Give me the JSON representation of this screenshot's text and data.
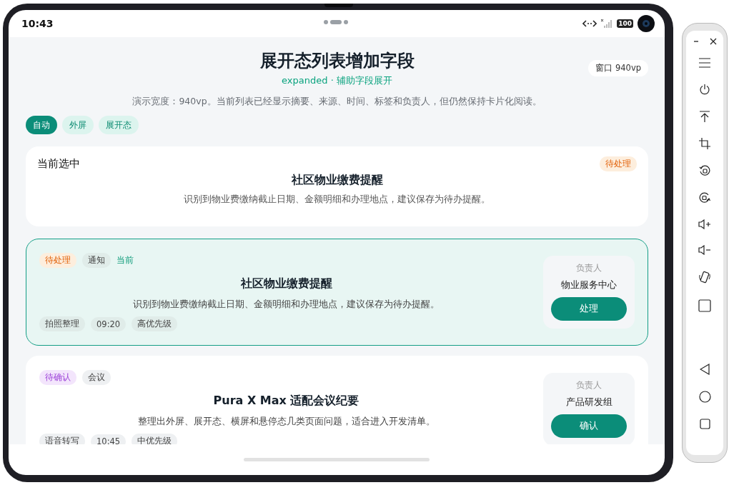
{
  "status_bar": {
    "time": "10:43",
    "battery": "100"
  },
  "header": {
    "title": "展开态列表增加字段",
    "subtitle": "expanded · 辅助字段展开",
    "window_badge": "窗口 940vp",
    "description": "演示宽度：940vp。当前列表已经显示摘要、来源、时间、标签和负责人，但仍然保持卡片化阅读。"
  },
  "filters": [
    {
      "label": "自动",
      "selected": true
    },
    {
      "label": "外屏",
      "selected": false
    },
    {
      "label": "展开态",
      "selected": false
    }
  ],
  "current": {
    "label": "当前选中",
    "status": {
      "text": "待处理",
      "kind": "pending"
    },
    "title": "社区物业缴费提醒",
    "summary": "识别到物业费缴纳截止日期、金额明细和办理地点，建议保存为待办提醒。"
  },
  "items": [
    {
      "selected": true,
      "status": {
        "text": "待处理",
        "kind": "pending"
      },
      "category": "通知",
      "current_tag": "当前",
      "title": "社区物业缴费提醒",
      "summary": "识别到物业费缴纳截止日期、金额明细和办理地点，建议保存为待办提醒。",
      "tags": [
        "拍照整理",
        "09:20",
        "高优先级"
      ],
      "owner_label": "负责人",
      "owner": "物业服务中心",
      "action": "处理"
    },
    {
      "selected": false,
      "status": {
        "text": "待确认",
        "kind": "confirm"
      },
      "category": "会议",
      "title": "Pura X Max 适配会议纪要",
      "summary": "整理出外屏、展开态、横屏和悬停态几类页面问题，适合进入开发清单。",
      "tags": [
        "语音转写",
        "10:45",
        "中优先级"
      ],
      "owner_label": "负责人",
      "owner": "产品研发组",
      "action": "确认"
    }
  ]
}
